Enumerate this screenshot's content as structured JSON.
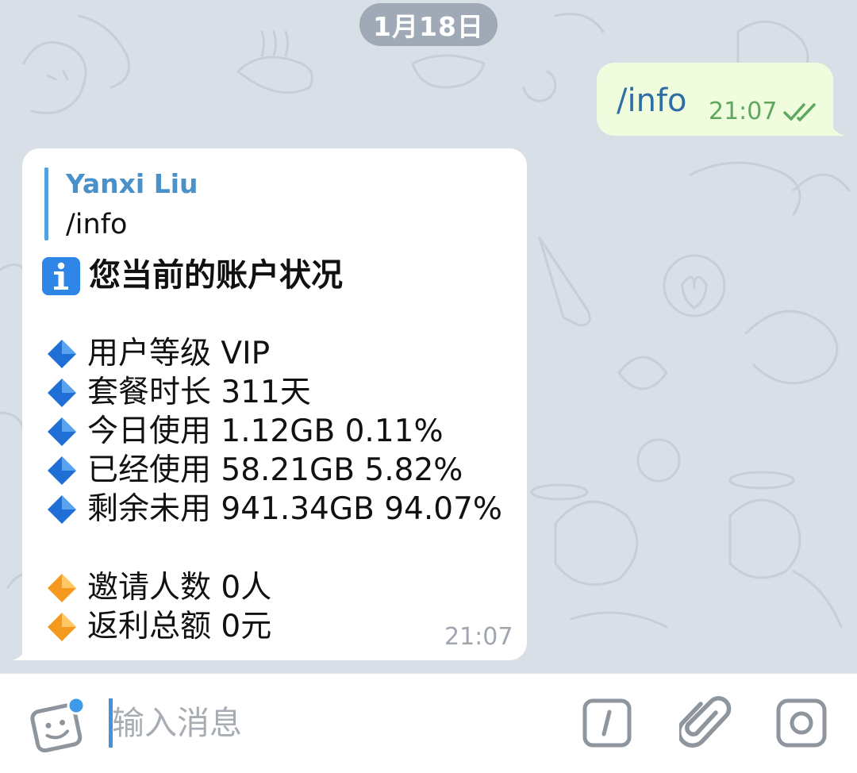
{
  "chat": {
    "date_separator": "1月18日",
    "outgoing": {
      "text": "/info",
      "time": "21:07",
      "status_icon": "double-check-icon"
    },
    "incoming": {
      "reply": {
        "author": "Yanxi Liu",
        "text": "/info"
      },
      "heading_icon": "information-icon",
      "heading": "您当前的账户状况",
      "stats": [
        {
          "icon": "blue-diamond-icon",
          "text": "用户等级 VIP"
        },
        {
          "icon": "blue-diamond-icon",
          "text": "套餐时长 311天"
        },
        {
          "icon": "blue-diamond-icon",
          "text": "今日使用 1.12GB 0.11%"
        },
        {
          "icon": "blue-diamond-icon",
          "text": "已经使用 58.21GB 5.82%"
        },
        {
          "icon": "blue-diamond-icon",
          "text": "剩余未用 941.34GB 94.07%"
        }
      ],
      "referral": [
        {
          "icon": "orange-diamond-icon",
          "text": "邀请人数 0人"
        },
        {
          "icon": "orange-diamond-icon",
          "text": "返利总额 0元"
        }
      ],
      "time": "21:07"
    }
  },
  "input_bar": {
    "placeholder": "输入消息",
    "left_icon": "sticker-icon",
    "right_icons": [
      "bot-command-icon",
      "attach-icon",
      "camera-icon"
    ]
  },
  "colors": {
    "wallpaper": "#d8dfe6",
    "outgoing_bubble": "#effdde",
    "incoming_bubble": "#ffffff",
    "link_blue": "#4a90c9",
    "timestamp_green": "#5fa75f",
    "blue_diamond": "#1f6fd6",
    "orange_diamond": "#f59a1e"
  }
}
